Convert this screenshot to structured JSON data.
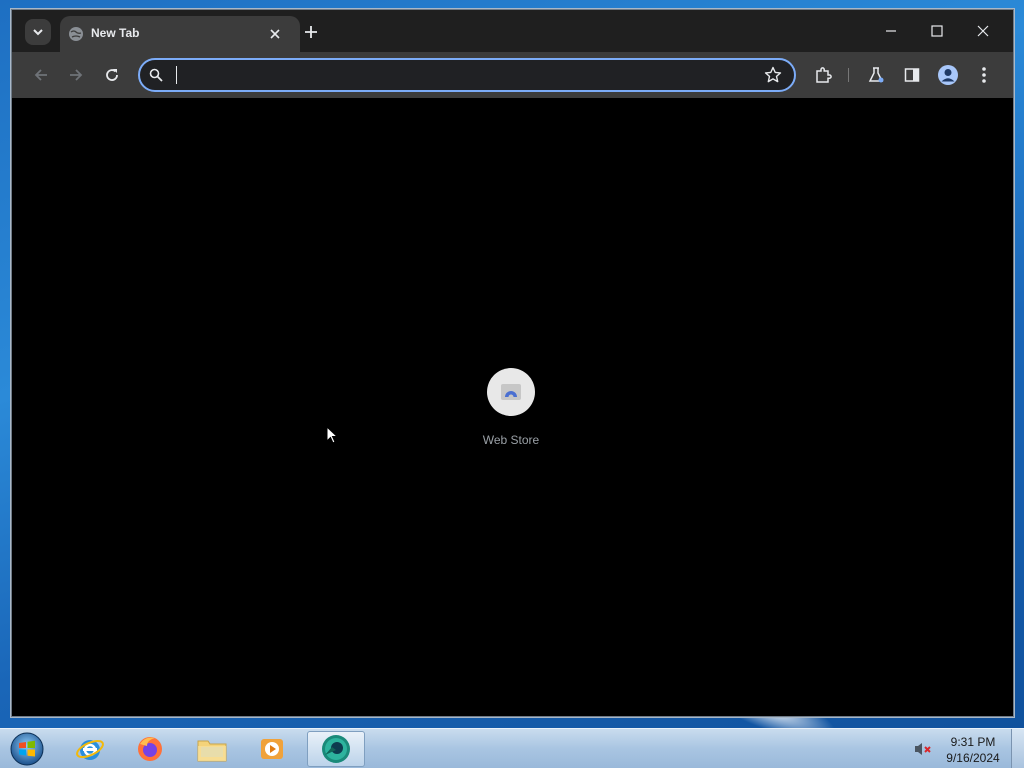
{
  "browser": {
    "tab": {
      "title": "New Tab"
    },
    "omnibox": {
      "value": "",
      "placeholder": ""
    },
    "accent_color": "#7cacf8"
  },
  "newtab": {
    "shortcuts": [
      {
        "label": "Web Store",
        "icon": "web-store-icon"
      }
    ]
  },
  "taskbar": {
    "apps": [
      {
        "name": "internet-explorer",
        "icon": "ie-icon"
      },
      {
        "name": "firefox",
        "icon": "firefox-icon"
      },
      {
        "name": "file-explorer",
        "icon": "folder-icon"
      },
      {
        "name": "media-player",
        "icon": "media-player-icon"
      },
      {
        "name": "chrome-beta",
        "icon": "chrome-icon",
        "active": true
      }
    ],
    "clock": {
      "time": "9:31 PM",
      "date": "9/16/2024"
    }
  }
}
